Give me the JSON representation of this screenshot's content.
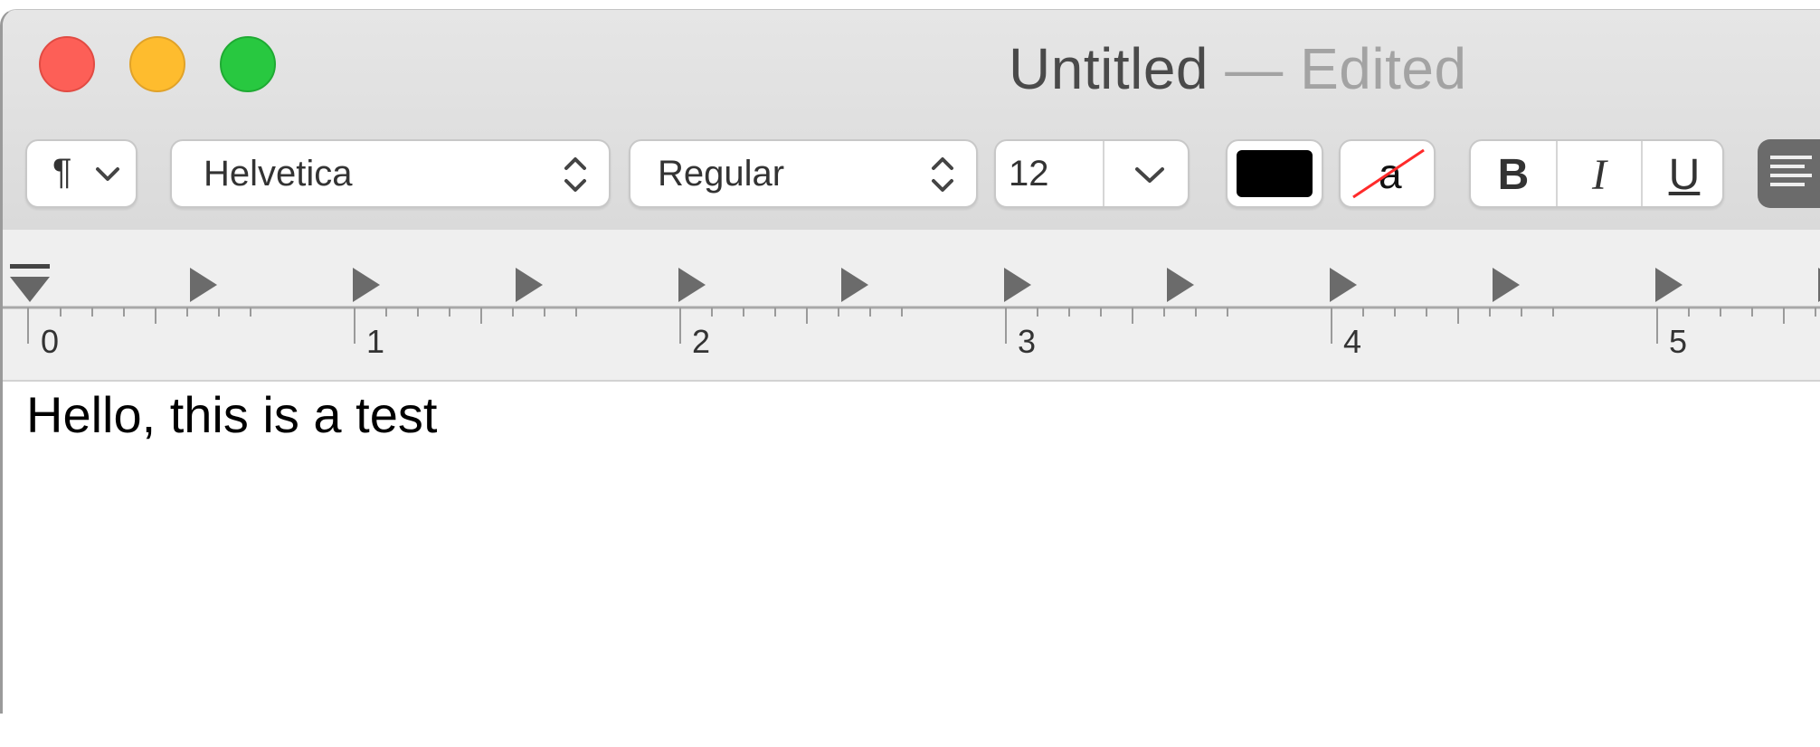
{
  "window": {
    "title": "Untitled",
    "title_suffix": "— Edited"
  },
  "toolbar": {
    "paragraph_symbol": "¶",
    "font_family": "Helvetica",
    "font_style": "Regular",
    "font_size": "12",
    "text_color": "#000000",
    "background_color_glyph": "a",
    "bold_label": "B",
    "italic_label": "I",
    "underline_label": "U"
  },
  "ruler": {
    "labels": [
      "0",
      "1",
      "2",
      "3",
      "4",
      "5"
    ]
  },
  "document": {
    "text": "Hello, this is a test"
  },
  "colors": {
    "close": "#fd5f57",
    "minimize": "#febc2e",
    "maximize": "#28c840",
    "align_button": "#6b6b6b"
  },
  "icons": {
    "paragraph": "paragraph-icon",
    "chevron": "chevron-down-icon",
    "stepper": "up-down-stepper-icon",
    "align_left": "align-left-icon",
    "tab_stop": "tab-stop-icon",
    "indent_marker": "indent-marker-icon"
  }
}
